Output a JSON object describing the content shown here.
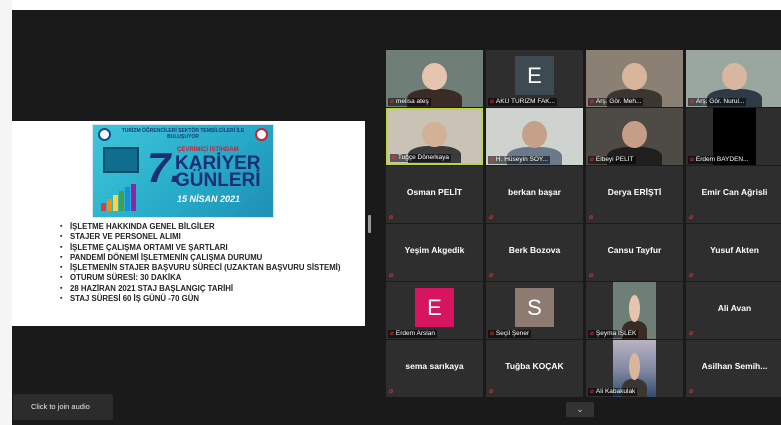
{
  "slide": {
    "banner": {
      "headline": "TURİZM ÖĞRENCİLERİ SEKTÖR TEMSİLCİLERİ İLE BULUŞUYOR",
      "number": "7.",
      "subtitle": "ÇEVRİMİÇİ İSTİHDAM",
      "title_line1": "KARİYER",
      "title_line2": "GÜNLERİ",
      "date": "15 NİSAN 2021"
    },
    "bullets": [
      "İŞLETME HAKKINDA GENEL BİLGİLER",
      "STAJER VE PERSONEL ALIMI",
      "İŞLETME ÇALIŞMA ORTAMI VE ŞARTLARI",
      "PANDEMİ DÖNEMİ İŞLETMENİN ÇALIŞMA DURUMU",
      "İŞLETMENİN STAJER BAŞVURU SÜRECİ (UZAKTAN BAŞVURU SİSTEMİ)",
      "OTURUM SÜRESİ: 30 DAKİKA",
      "28 HAZİRAN 2021 STAJ BAŞLANGIÇ TARİHİ",
      "STAJ SÜRESİ 60 İŞ GÜNÜ -70 GÜN"
    ]
  },
  "participants": [
    {
      "label": "melisa ateş",
      "kind": "video"
    },
    {
      "label": "AKÜ TURİZM FAK...",
      "kind": "avatar",
      "initial": "E",
      "color": "#3d4a52"
    },
    {
      "label": "Arş. Gör. Meh...",
      "kind": "video"
    },
    {
      "label": "Arş. Gör. Nurul...",
      "kind": "video"
    },
    {
      "label": "Tuğçe Dönerkaya",
      "kind": "video",
      "active": true
    },
    {
      "label": "H. Hüseyin SOY...",
      "kind": "video"
    },
    {
      "label": "Elbeyi PELİT",
      "kind": "video"
    },
    {
      "label": "Erdem BAYDEN...",
      "kind": "blank"
    },
    {
      "label": "Osman PELİT",
      "kind": "name"
    },
    {
      "label": "berkan başar",
      "kind": "name"
    },
    {
      "label": "Derya ERİŞTİ",
      "kind": "name"
    },
    {
      "label": "Emir Can Ağrisli",
      "kind": "name"
    },
    {
      "label": "Yeşim Akgedik",
      "kind": "name"
    },
    {
      "label": "Berk Bozova",
      "kind": "name"
    },
    {
      "label": "Cansu Tayfur",
      "kind": "name"
    },
    {
      "label": "Yusuf Akten",
      "kind": "name"
    },
    {
      "label": "Erdem Arslan",
      "kind": "avatar",
      "initial": "E",
      "color": "#d6145f"
    },
    {
      "label": "Seçil Şener",
      "kind": "avatar",
      "initial": "S",
      "color": "#8d7b72"
    },
    {
      "label": "Şeyma İŞLEK",
      "kind": "photo"
    },
    {
      "label": "Ali Avan",
      "kind": "name"
    },
    {
      "label": "sema sarıkaya",
      "kind": "name"
    },
    {
      "label": "Tuğba KOÇAK",
      "kind": "name"
    },
    {
      "label": "Ali Kabakulak",
      "kind": "photo"
    },
    {
      "label": "Asilhan Semih...",
      "kind": "name"
    }
  ],
  "controls": {
    "join_audio": "Click to join audio",
    "chevron": "⌄"
  }
}
